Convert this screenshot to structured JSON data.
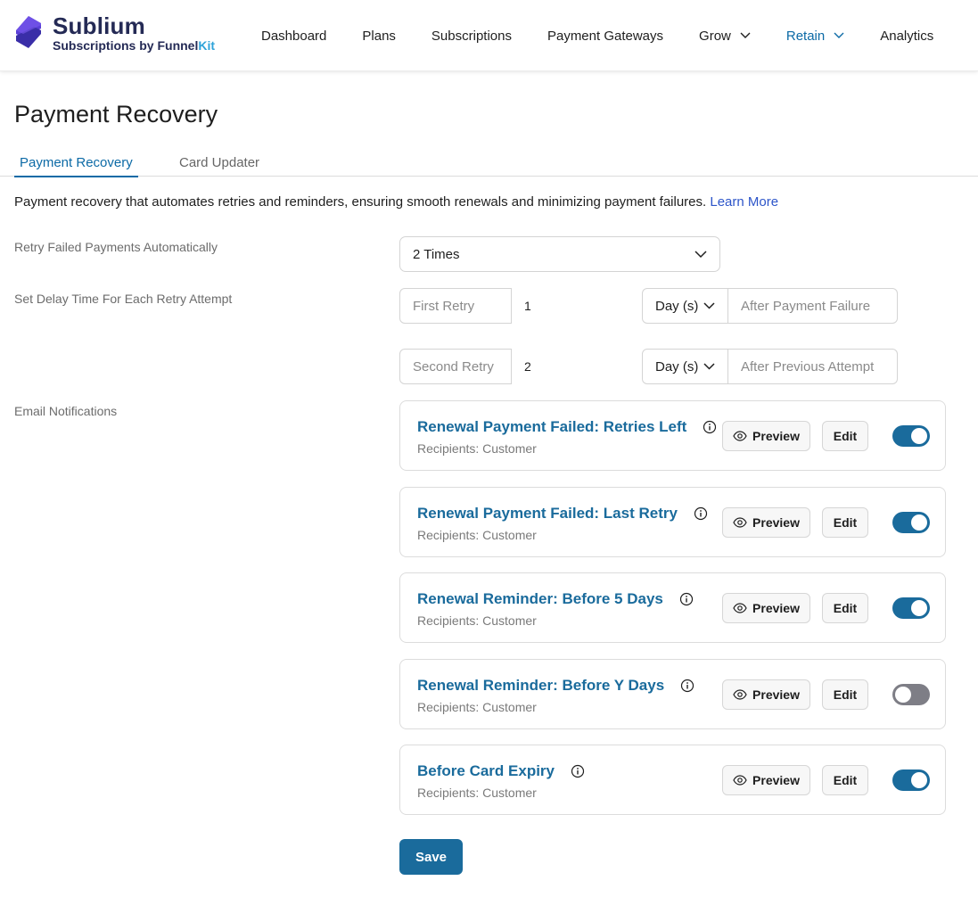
{
  "brand": {
    "name": "Sublium",
    "tagline_prefix": "Subscriptions by Funnel",
    "tagline_suffix": "Kit"
  },
  "nav": [
    {
      "label": "Dashboard",
      "dropdown": false,
      "active": false
    },
    {
      "label": "Plans",
      "dropdown": false,
      "active": false
    },
    {
      "label": "Subscriptions",
      "dropdown": false,
      "active": false
    },
    {
      "label": "Payment Gateways",
      "dropdown": false,
      "active": false
    },
    {
      "label": "Grow",
      "dropdown": true,
      "active": false
    },
    {
      "label": "Retain",
      "dropdown": true,
      "active": true
    },
    {
      "label": "Analytics",
      "dropdown": false,
      "active": false
    }
  ],
  "page": {
    "title": "Payment Recovery"
  },
  "tabs": {
    "active": "Payment Recovery",
    "inactive": "Card Updater"
  },
  "description": {
    "text": "Payment recovery that automates retries and reminders, ensuring smooth renewals and minimizing payment failures.",
    "link": "Learn More"
  },
  "retry": {
    "label": "Retry Failed Payments Automatically",
    "value": "2 Times"
  },
  "delay": {
    "label": "Set Delay Time For Each Retry Attempt",
    "rows": [
      {
        "name": "First Retry",
        "value": "1",
        "unit": "Day (s)",
        "after": "After Payment Failure"
      },
      {
        "name": "Second Retry",
        "value": "2",
        "unit": "Day (s)",
        "after": "After Previous Attempt"
      }
    ]
  },
  "email": {
    "label": "Email Notifications",
    "preview_label": "Preview",
    "edit_label": "Edit",
    "items": [
      {
        "title": "Renewal Payment Failed: Retries Left",
        "recipients": "Recipients: Customer",
        "enabled": true
      },
      {
        "title": "Renewal Payment Failed: Last Retry",
        "recipients": "Recipients: Customer",
        "enabled": true
      },
      {
        "title": "Renewal Reminder: Before 5 Days",
        "recipients": "Recipients: Customer",
        "enabled": true
      },
      {
        "title": "Renewal Reminder: Before Y Days",
        "recipients": "Recipients: Customer",
        "enabled": false
      },
      {
        "title": "Before Card Expiry",
        "recipients": "Recipients: Customer",
        "enabled": true
      }
    ]
  },
  "save_label": "Save",
  "colors": {
    "brand_dark": "#242a55",
    "accent": "#1a6b9c",
    "kit": "#2ea3d9",
    "link": "#2d55c9",
    "toggle_off": "#7e7e86"
  },
  "icons": {
    "logo": "sublium-logo",
    "chevron": "chevron-down-icon",
    "info": "info-icon",
    "preview": "eye-icon"
  }
}
